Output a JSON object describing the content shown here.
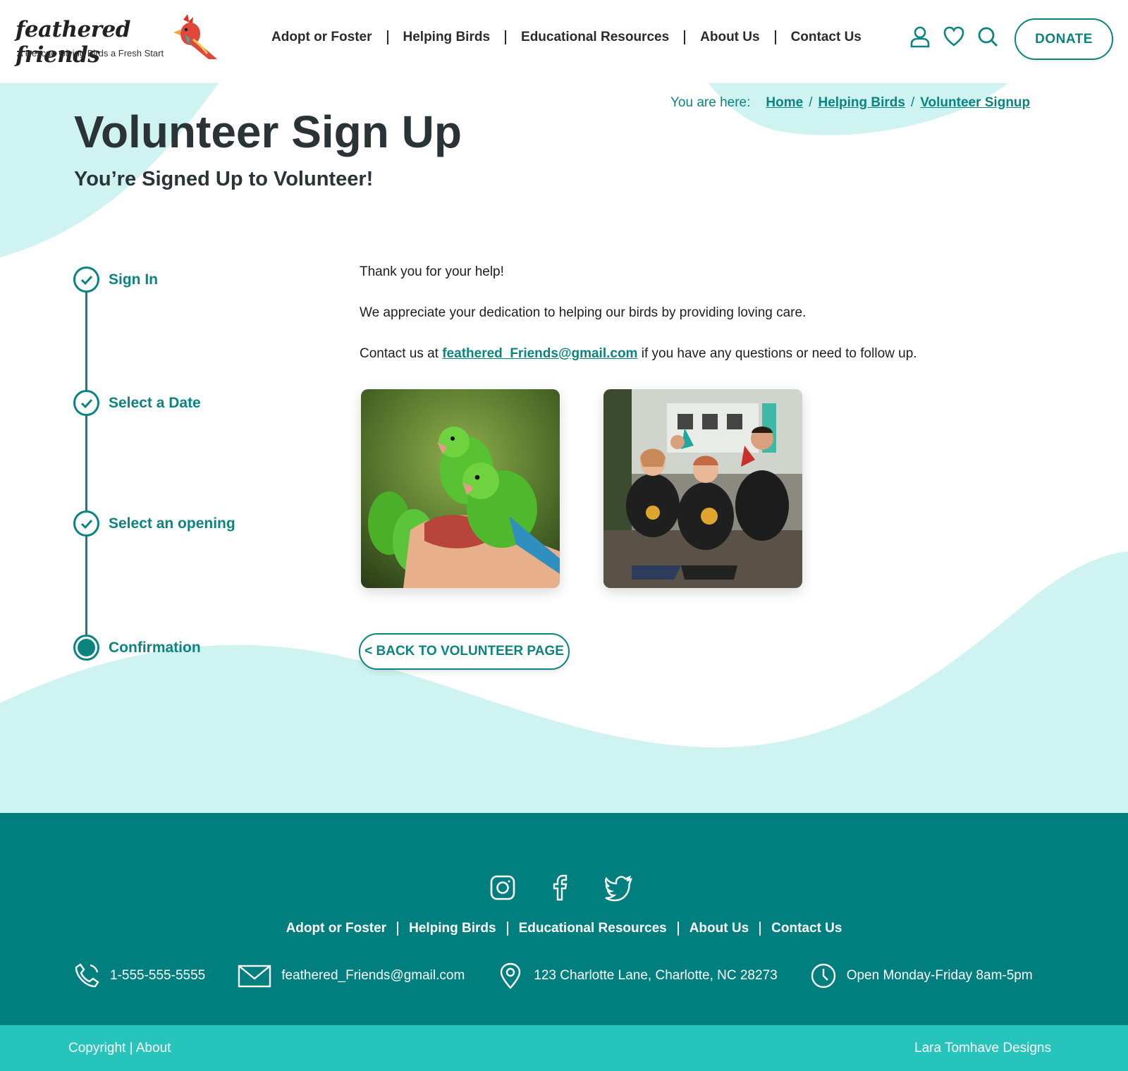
{
  "brand": {
    "name": "feathered friends",
    "tagline": "A Rescue Giving Birds a Fresh Start"
  },
  "nav": {
    "items": [
      "Adopt or Foster",
      "Helping Birds",
      "Educational Resources",
      "About Us",
      "Contact Us"
    ],
    "donate_label": "DONATE",
    "icons": [
      "user-icon",
      "heart-icon",
      "search-icon"
    ]
  },
  "breadcrumb": {
    "label": "You are here:",
    "items": [
      "Home",
      "Helping Birds",
      "Volunteer Signup"
    ],
    "separator": "/"
  },
  "hero": {
    "title": "Volunteer Sign Up",
    "subtitle": "You’re Signed Up to Volunteer!"
  },
  "steps": [
    {
      "label": "Sign In",
      "state": "complete"
    },
    {
      "label": "Select a Date",
      "state": "complete"
    },
    {
      "label": "Select an opening",
      "state": "complete"
    },
    {
      "label": "Confirmation",
      "state": "current"
    }
  ],
  "content": {
    "thanks": "Thank you for your help!",
    "appreciate": "We appreciate your dedication to helping our birds by providing loving care.",
    "contact_prefix": "Contact us at",
    "contact_email": "feathered_Friends@gmail.com",
    "contact_suffix": "if you have any questions or need to follow up.",
    "back_label": "< BACK TO VOLUNTEER PAGE"
  },
  "footer": {
    "social": [
      "instagram-icon",
      "facebook-icon",
      "twitter-icon"
    ],
    "nav": [
      "Adopt or Foster",
      "Helping Birds",
      "Educational Resources",
      "About Us",
      "Contact Us"
    ],
    "phone": "1-555-555-5555",
    "email": "feathered_Friends@gmail.com",
    "address": "123 Charlotte Lane, Charlotte, NC 28273",
    "hours": "Open Monday-Friday 8am-5pm",
    "copyright": "Copyright | About",
    "credit": "Lara Tomhave Designs"
  },
  "colors": {
    "teal": "#0b8480",
    "footer": "#007f7e",
    "copybar": "#27c4bb",
    "mint": "#cef3f1"
  }
}
